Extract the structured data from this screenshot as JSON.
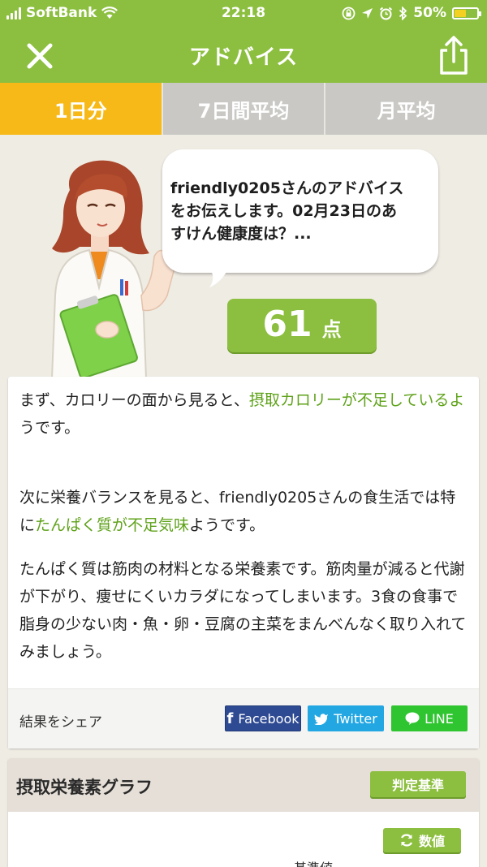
{
  "status_bar": {
    "carrier": "SoftBank",
    "time": "22:18",
    "battery": "50%",
    "battery_level": 0.5
  },
  "nav": {
    "title": "アドバイス"
  },
  "tabs": [
    {
      "label": "1日分",
      "active": true
    },
    {
      "label": "7日間平均",
      "active": false
    },
    {
      "label": "月平均",
      "active": false
    }
  ],
  "speech": {
    "line1": "friendly0205さんのアドバイス",
    "line2": "をお伝えします。02月23日のあ",
    "line3": "すけん健康度は？..."
  },
  "score": {
    "value": "61",
    "unit": "点"
  },
  "advice": {
    "p1_a": "まず、カロリーの面から見ると、",
    "p1_hl": "摂取カロリーが不足しているよ",
    "p1_b": "うです。",
    "p2_a": "次に栄養バランスを見ると、friendly0205さんの食生活では特に",
    "p2_hl": "たんぱく質が不足気味",
    "p2_b": "ようです。",
    "p3": "たんぱく質は筋肉の材料となる栄養素です。筋肉量が減ると代謝が下がり、痩せにくいカラダになってしまいます。3食の食事で脂身の少ない肉・魚・卵・豆腐の主菜をまんべんなく取り入れてみましょう。"
  },
  "share": {
    "label": "結果をシェア",
    "facebook": "Facebook",
    "twitter": "Twitter",
    "line": "LINE"
  },
  "graph": {
    "title": "摂取栄養素グラフ",
    "criteria_button": "判定基準",
    "value_button": "数値",
    "baseline_label": "基準値"
  },
  "colors": {
    "brand_green": "#8cbf3f",
    "active_tab": "#f6b917",
    "highlight_green": "#5fa21a",
    "facebook": "#2e4a92",
    "twitter": "#23a7e3",
    "line": "#2fc530"
  },
  "icons": [
    "signal-icon",
    "wifi-icon",
    "lock-rotation-icon",
    "location-icon",
    "alarm-icon",
    "bluetooth-icon",
    "battery-icon",
    "close-icon",
    "share-icon",
    "facebook-icon",
    "twitter-icon",
    "line-icon",
    "refresh-icon"
  ]
}
